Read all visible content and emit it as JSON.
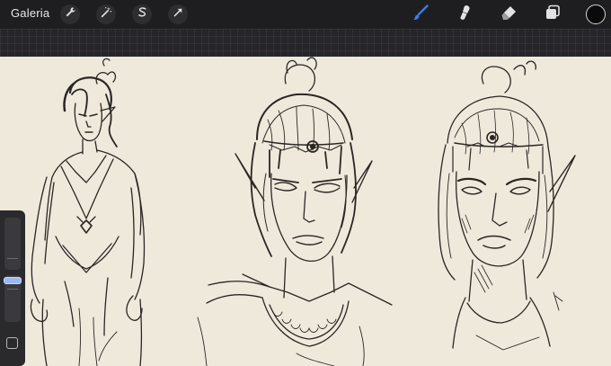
{
  "toolbar": {
    "gallery_label": "Galeria",
    "left_tools": [
      {
        "name": "actions",
        "icon": "wrench-icon"
      },
      {
        "name": "adjustments",
        "icon": "magic-wand-icon"
      },
      {
        "name": "selection",
        "icon": "selection-s-icon"
      },
      {
        "name": "transform",
        "icon": "arrow-cursor-icon"
      }
    ],
    "right_tools": [
      {
        "name": "brush",
        "icon": "brush-icon",
        "active": true
      },
      {
        "name": "smudge",
        "icon": "smudge-icon",
        "active": false
      },
      {
        "name": "eraser",
        "icon": "eraser-icon",
        "active": false
      },
      {
        "name": "layers",
        "icon": "layers-icon",
        "active": false
      }
    ],
    "current_color": "#0a0a0a",
    "accent_color": "#3b7bf0"
  },
  "sidebar": {
    "brush_size_level": 0.45,
    "opacity_level": 0.6
  },
  "canvas": {
    "paper_color": "#efe9dc",
    "content": "pencil-sketch-of-three-figures"
  }
}
